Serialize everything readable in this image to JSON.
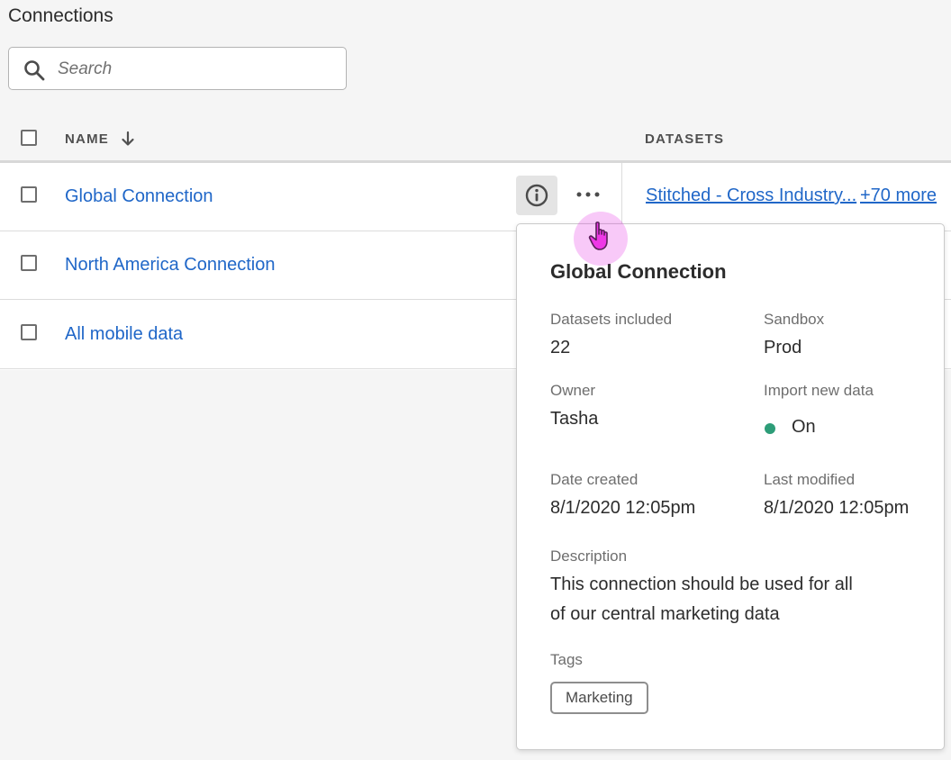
{
  "page": {
    "title": "Connections"
  },
  "search": {
    "placeholder": "Search",
    "icon": "search-icon"
  },
  "table": {
    "columns": {
      "name": "NAME",
      "datasets": "DATASETS"
    },
    "sort_icon": "arrow-down-icon",
    "rows": [
      {
        "name": "Global Connection",
        "datasets_link": "Stitched - Cross Industry...",
        "more_datasets": "+70 more"
      },
      {
        "name": "North America Connection"
      },
      {
        "name": "All mobile data"
      }
    ]
  },
  "popover": {
    "title": "Global Connection",
    "fields": {
      "datasets_included_label": "Datasets included",
      "datasets_included_value": "22",
      "sandbox_label": "Sandbox",
      "sandbox_value": "Prod",
      "owner_label": "Owner",
      "owner_value": "Tasha",
      "import_label": "Import new data",
      "import_value": "On",
      "date_created_label": "Date created",
      "date_created_value": "8/1/2020 12:05pm",
      "last_modified_label": "Last modified",
      "last_modified_value": "8/1/2020 12:05pm",
      "description_label": "Description",
      "description_line1": "This connection should be used for all",
      "description_line2": "of our central marketing data",
      "tags_label": "Tags"
    },
    "tags": [
      "Marketing"
    ]
  },
  "colors": {
    "link": "#2067c8",
    "status_on": "#2d9d78",
    "cursor_highlight": "#e63ce6"
  }
}
